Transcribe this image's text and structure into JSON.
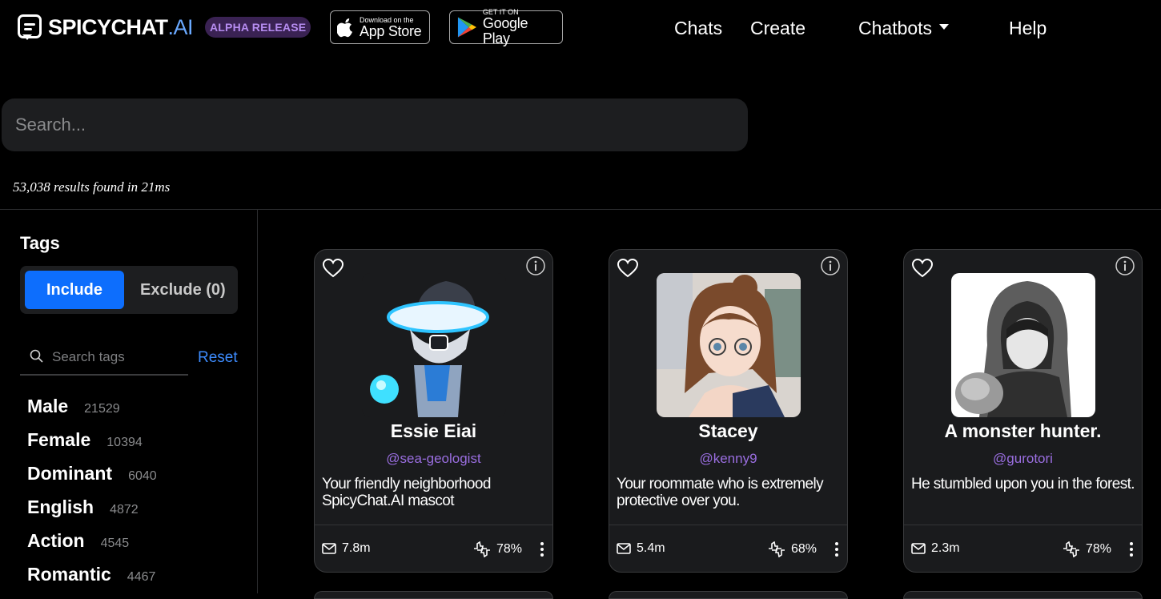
{
  "header": {
    "logo_text": "SPICYCHAT",
    "logo_suffix": ".AI",
    "badge": "ALPHA RELEASE",
    "app_store": {
      "small": "Download on the",
      "big": "App Store"
    },
    "google_play": {
      "small": "GET IT ON",
      "big": "Google Play"
    },
    "nav": {
      "chats": "Chats",
      "create": "Create",
      "chatbots": "Chatbots",
      "help": "Help"
    }
  },
  "search": {
    "placeholder": "Search..."
  },
  "results_text": "53,038 results found in 21ms",
  "sidebar": {
    "title": "Tags",
    "include_label": "Include",
    "exclude_label": "Exclude (0)",
    "tag_search_placeholder": "Search tags",
    "reset_label": "Reset",
    "tags": [
      {
        "name": "Male",
        "count": "21529"
      },
      {
        "name": "Female",
        "count": "10394"
      },
      {
        "name": "Dominant",
        "count": "6040"
      },
      {
        "name": "English",
        "count": "4872"
      },
      {
        "name": "Action",
        "count": "4545"
      },
      {
        "name": "Romantic",
        "count": "4467"
      }
    ]
  },
  "cards": [
    {
      "name": "Essie Eiai",
      "handle": "@sea-geologist",
      "description": "Your friendly neighborhood SpicyChat.AI mascot",
      "messages": "7.8m",
      "rating": "78%"
    },
    {
      "name": "Stacey",
      "handle": "@kenny9",
      "description": "Your roommate who is extremely protective over you.",
      "messages": "5.4m",
      "rating": "68%"
    },
    {
      "name": "A monster hunter.",
      "handle": "@gurotori",
      "description": "He stumbled upon you in the forest.",
      "messages": "2.3m",
      "rating": "78%"
    }
  ],
  "colors": {
    "accent": "#0d6efd",
    "handle": "#9a6ee0",
    "badge_bg": "#3a2253",
    "badge_text": "#b68cf0",
    "card_bg": "#1a1b1d"
  }
}
